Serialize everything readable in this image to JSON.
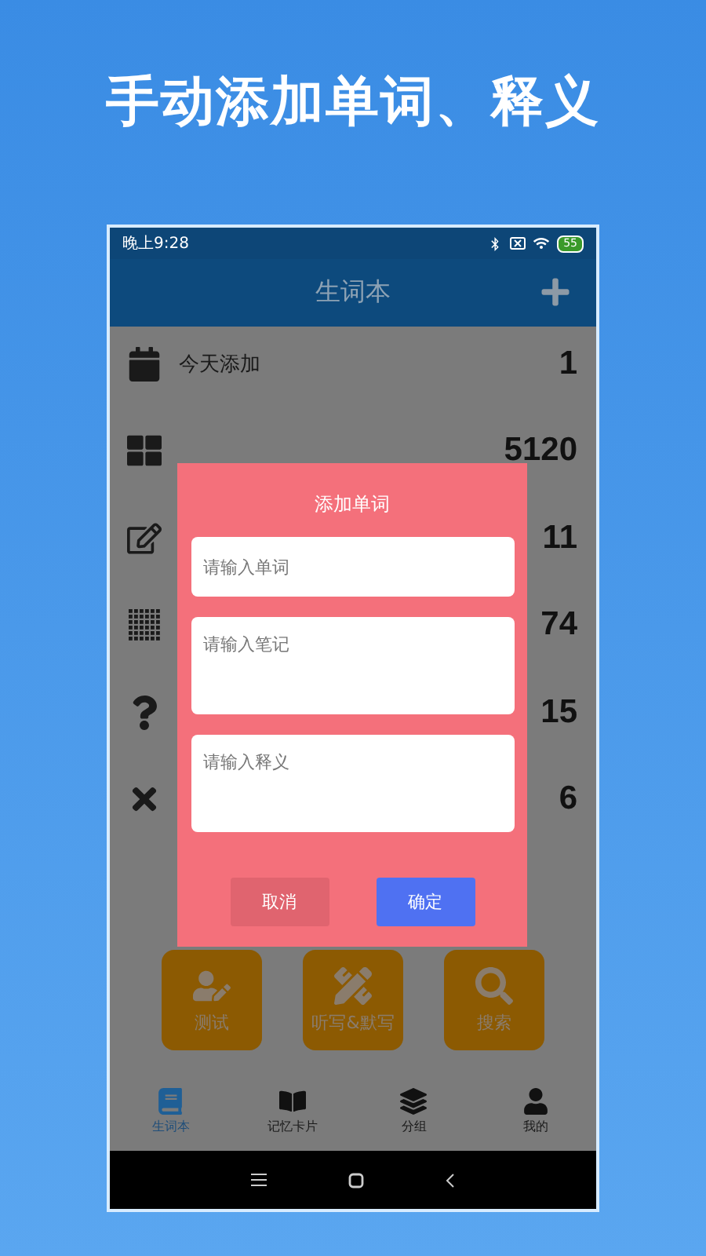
{
  "headline": "手动添加单词、释义",
  "status_bar": {
    "time": "晚上9:28",
    "battery": "55"
  },
  "header": {
    "title": "生词本"
  },
  "stats": [
    {
      "label": "今天添加",
      "count": "1"
    },
    {
      "count": "5120"
    },
    {
      "count": "11"
    },
    {
      "count": "74"
    },
    {
      "count": "15"
    },
    {
      "count": "6"
    }
  ],
  "tiles": [
    {
      "label": "测试"
    },
    {
      "label": "听写&默写"
    },
    {
      "label": "搜索"
    }
  ],
  "tabs": [
    {
      "label": "生词本",
      "selected": true
    },
    {
      "label": "记忆卡片",
      "selected": false
    },
    {
      "label": "分组",
      "selected": false
    },
    {
      "label": "我的",
      "selected": false
    }
  ],
  "dialog": {
    "title": "添加单词",
    "fields": [
      {
        "placeholder": "请输入单词",
        "kind": "line"
      },
      {
        "placeholder": "请输入笔记",
        "kind": "area"
      },
      {
        "placeholder": "请输入释义",
        "kind": "area"
      }
    ],
    "buttons": [
      {
        "label": "取消",
        "kind": "cancel"
      },
      {
        "label": "确定",
        "kind": "ok"
      }
    ]
  }
}
